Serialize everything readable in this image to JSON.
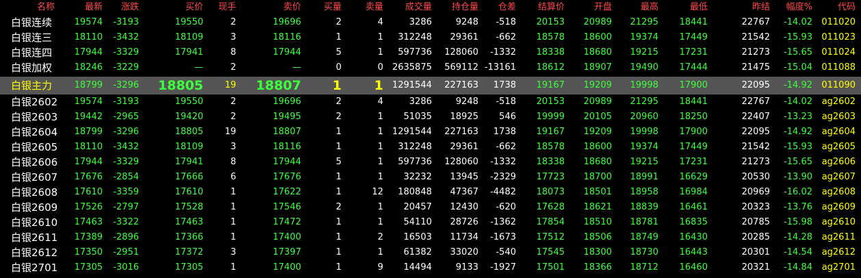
{
  "colors": {
    "header": "#ff4a4a",
    "green": "#3cff3c",
    "white": "#ffffff",
    "yellow": "#ffff00",
    "selected_bg": "#555555"
  },
  "columns": [
    "名称",
    "最新",
    "涨跌",
    "买价",
    "现手",
    "卖价",
    "买量",
    "卖量",
    "成交量",
    "持仓量",
    "仓差",
    "结算价",
    "开盘",
    "最高",
    "最低",
    "昨结",
    "幅度%",
    "代码"
  ],
  "selected_index": 4,
  "rows": [
    [
      "白银连续",
      "19574",
      "-3193",
      "19550",
      "2",
      "19696",
      "2",
      "4",
      "3286",
      "9248",
      "-518",
      "20153",
      "20989",
      "21295",
      "18441",
      "22767",
      "-14.02",
      "011020"
    ],
    [
      "白银连三",
      "18110",
      "-3432",
      "18109",
      "3",
      "18116",
      "1",
      "1",
      "312248",
      "29361",
      "-662",
      "18578",
      "18600",
      "19374",
      "17449",
      "21542",
      "-15.93",
      "011023"
    ],
    [
      "白银连四",
      "17944",
      "-3329",
      "17941",
      "8",
      "17944",
      "5",
      "1",
      "597736",
      "128060",
      "-1332",
      "18338",
      "18680",
      "19215",
      "17231",
      "21273",
      "-15.65",
      "011024"
    ],
    [
      "白银加权",
      "18246",
      "-3229",
      "—",
      "2",
      "—",
      "0",
      "0",
      "2635875",
      "569112",
      "-13161",
      "18612",
      "18907",
      "19490",
      "17444",
      "21475",
      "-15.04",
      "011088"
    ],
    [
      "白银主力",
      "18799",
      "-3296",
      "18805",
      "19",
      "18807",
      "1",
      "1",
      "1291544",
      "227163",
      "1738",
      "19167",
      "19209",
      "19998",
      "17900",
      "22095",
      "-14.92",
      "011090"
    ],
    [
      "白银2602",
      "19574",
      "-3193",
      "19550",
      "2",
      "19696",
      "2",
      "4",
      "3286",
      "9248",
      "-518",
      "20153",
      "20989",
      "21295",
      "18441",
      "22767",
      "-14.02",
      "ag2602"
    ],
    [
      "白银2603",
      "19442",
      "-2965",
      "19420",
      "2",
      "19495",
      "2",
      "1",
      "51035",
      "18925",
      "546",
      "19999",
      "20105",
      "20960",
      "18250",
      "22407",
      "-13.23",
      "ag2603"
    ],
    [
      "白银2604",
      "18799",
      "-3296",
      "18805",
      "19",
      "18807",
      "1",
      "1",
      "1291544",
      "227163",
      "1738",
      "19167",
      "19209",
      "19998",
      "17900",
      "22095",
      "-14.92",
      "ag2604"
    ],
    [
      "白银2605",
      "18110",
      "-3432",
      "18109",
      "3",
      "18116",
      "1",
      "1",
      "312248",
      "29361",
      "-662",
      "18578",
      "18600",
      "19374",
      "17449",
      "21542",
      "-15.93",
      "ag2605"
    ],
    [
      "白银2606",
      "17944",
      "-3329",
      "17941",
      "8",
      "17944",
      "5",
      "1",
      "597736",
      "128060",
      "-1332",
      "18338",
      "18680",
      "19215",
      "17231",
      "21273",
      "-15.65",
      "ag2606"
    ],
    [
      "白银2607",
      "17676",
      "-2854",
      "17666",
      "6",
      "17676",
      "1",
      "1",
      "32232",
      "13945",
      "-2329",
      "17723",
      "18700",
      "18991",
      "16629",
      "20530",
      "-13.90",
      "ag2607"
    ],
    [
      "白银2608",
      "17610",
      "-3359",
      "17610",
      "1",
      "17622",
      "1",
      "12",
      "180848",
      "47367",
      "-4482",
      "18073",
      "18501",
      "18958",
      "16984",
      "20969",
      "-16.02",
      "ag2608"
    ],
    [
      "白银2609",
      "17526",
      "-2797",
      "17528",
      "1",
      "17546",
      "2",
      "1",
      "20457",
      "12430",
      "-620",
      "17628",
      "18621",
      "18839",
      "16461",
      "20323",
      "-13.76",
      "ag2609"
    ],
    [
      "白银2610",
      "17463",
      "-3322",
      "17463",
      "1",
      "17472",
      "1",
      "1",
      "54110",
      "28726",
      "-1362",
      "17854",
      "18510",
      "18781",
      "16835",
      "20785",
      "-15.98",
      "ag2610"
    ],
    [
      "白银2611",
      "17389",
      "-2896",
      "17366",
      "1",
      "17400",
      "1",
      "2",
      "16503",
      "11734",
      "-1673",
      "17512",
      "18506",
      "18749",
      "16430",
      "20285",
      "-14.28",
      "ag2611"
    ],
    [
      "白银2612",
      "17350",
      "-2951",
      "17372",
      "3",
      "17397",
      "1",
      "1",
      "61382",
      "33020",
      "-540",
      "17545",
      "18300",
      "18730",
      "16443",
      "20301",
      "-14.54",
      "ag2612"
    ],
    [
      "白银2701",
      "17305",
      "-3016",
      "17305",
      "1",
      "17400",
      "1",
      "9",
      "14494",
      "9133",
      "-1927",
      "17501",
      "18366",
      "18712",
      "16460",
      "20321",
      "-14.84",
      "ag2701"
    ]
  ]
}
